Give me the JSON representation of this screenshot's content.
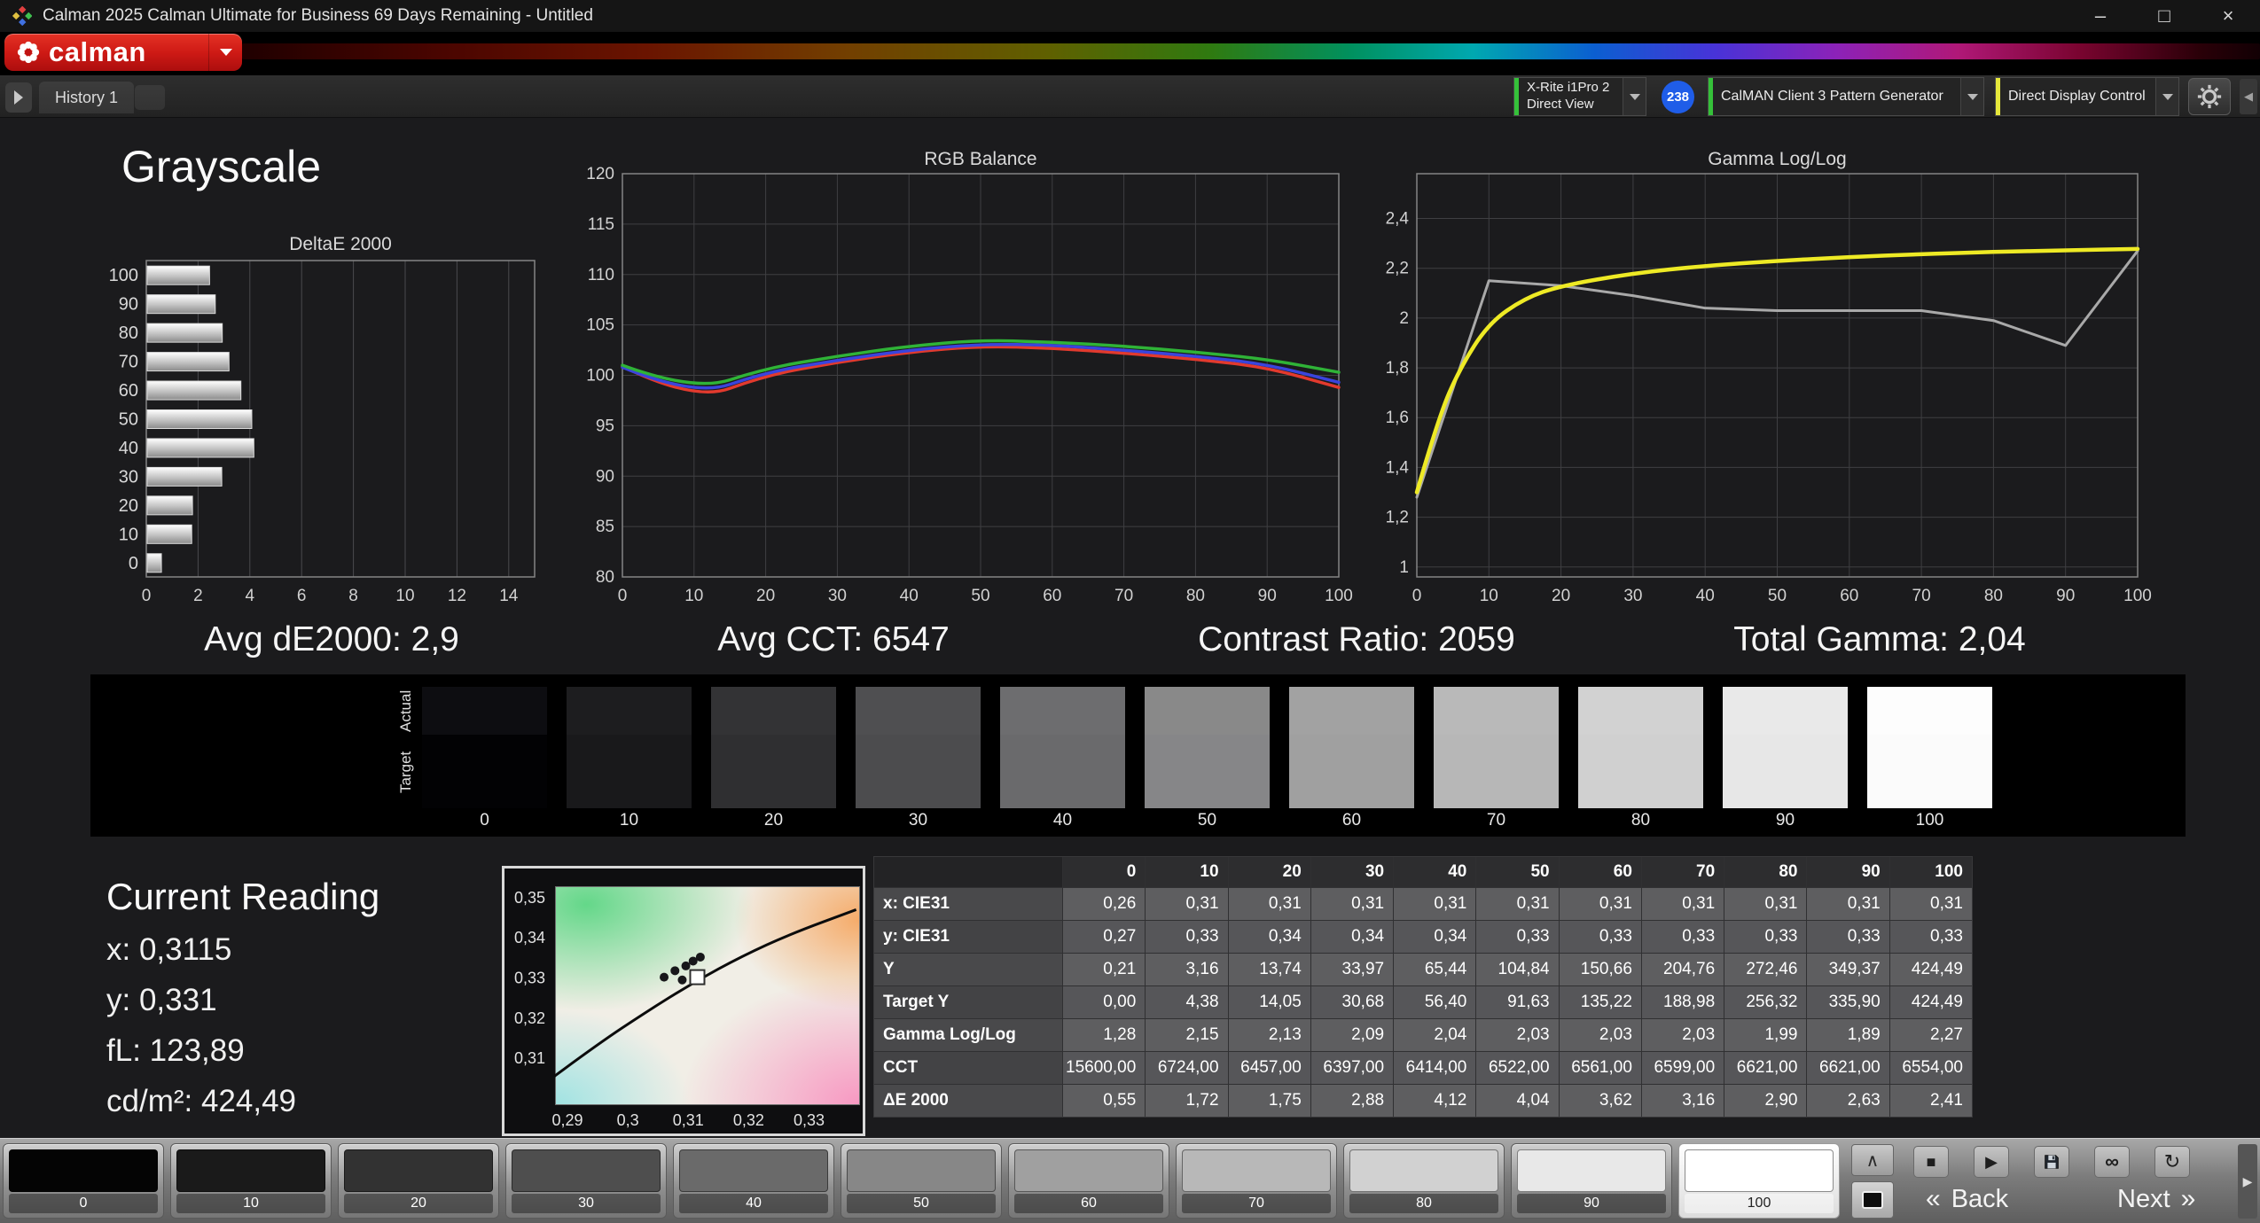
{
  "window": {
    "title": "Calman 2025 Calman Ultimate for Business 69 Days Remaining  - Untitled",
    "minimize": "–",
    "maximize": "□",
    "close": "×"
  },
  "brand": {
    "logo_text": "calman"
  },
  "toolbar": {
    "history_tab": "History 1",
    "meter_line1": "X-Rite i1Pro 2",
    "meter_line2": "Direct View",
    "meter_badge": "238",
    "pattern_source": "CalMAN Client 3 Pattern Generator",
    "display_control": "Direct Display Control",
    "accent_green": "#35c139",
    "accent_yellow": "#e6e83b"
  },
  "page": {
    "title": "Grayscale"
  },
  "stats": [
    "Avg dE2000: 2,9",
    "Avg CCT: 6547",
    "Contrast Ratio: 2059",
    "Total Gamma: 2,04"
  ],
  "current_reading": {
    "title": "Current Reading",
    "lines": [
      "x: 0,3115",
      "y: 0,331",
      "fL: 123,89",
      "cd/m²: 424,49"
    ]
  },
  "ramp": {
    "actual_label": "Actual",
    "target_label": "Target",
    "levels": [
      {
        "label": "0",
        "actual": "#0d0d11",
        "target": "#020204"
      },
      {
        "label": "10",
        "actual": "#1d1d1f",
        "target": "#19191b"
      },
      {
        "label": "20",
        "actual": "#333335",
        "target": "#2f2f31"
      },
      {
        "label": "30",
        "actual": "#4f4f51",
        "target": "#4c4c4e"
      },
      {
        "label": "40",
        "actual": "#6d6d6f",
        "target": "#6a6a6c"
      },
      {
        "label": "50",
        "actual": "#898989",
        "target": "#868688"
      },
      {
        "label": "60",
        "actual": "#a2a2a2",
        "target": "#a0a0a0"
      },
      {
        "label": "70",
        "actual": "#b9b9b9",
        "target": "#b7b7b7"
      },
      {
        "label": "80",
        "actual": "#d2d2d2",
        "target": "#d0d0d0"
      },
      {
        "label": "90",
        "actual": "#e9e9e9",
        "target": "#e7e7e7"
      },
      {
        "label": "100",
        "actual": "#fdfdfd",
        "target": "#fbfbfb"
      }
    ]
  },
  "table": {
    "columns": [
      "0",
      "10",
      "20",
      "30",
      "40",
      "50",
      "60",
      "70",
      "80",
      "90",
      "100"
    ],
    "rows": [
      {
        "label": "x: CIE31",
        "values": [
          "0,26",
          "0,31",
          "0,31",
          "0,31",
          "0,31",
          "0,31",
          "0,31",
          "0,31",
          "0,31",
          "0,31",
          "0,31"
        ]
      },
      {
        "label": "y: CIE31",
        "values": [
          "0,27",
          "0,33",
          "0,34",
          "0,34",
          "0,34",
          "0,33",
          "0,33",
          "0,33",
          "0,33",
          "0,33",
          "0,33"
        ]
      },
      {
        "label": "Y",
        "values": [
          "0,21",
          "3,16",
          "13,74",
          "33,97",
          "65,44",
          "104,84",
          "150,66",
          "204,76",
          "272,46",
          "349,37",
          "424,49"
        ]
      },
      {
        "label": "Target Y",
        "values": [
          "0,00",
          "4,38",
          "14,05",
          "30,68",
          "56,40",
          "91,63",
          "135,22",
          "188,98",
          "256,32",
          "335,90",
          "424,49"
        ]
      },
      {
        "label": "Gamma Log/Log",
        "values": [
          "1,28",
          "2,15",
          "2,13",
          "2,09",
          "2,04",
          "2,03",
          "2,03",
          "2,03",
          "1,99",
          "1,89",
          "2,27"
        ]
      },
      {
        "label": "CCT",
        "values": [
          "15600,00",
          "6724,00",
          "6457,00",
          "6397,00",
          "6414,00",
          "6522,00",
          "6561,00",
          "6599,00",
          "6621,00",
          "6621,00",
          "6554,00"
        ]
      },
      {
        "label": "ΔE 2000",
        "values": [
          "0,55",
          "1,72",
          "1,75",
          "2,88",
          "4,12",
          "4,04",
          "3,62",
          "3,16",
          "2,90",
          "2,63",
          "2,41"
        ]
      }
    ]
  },
  "pattern_bar": {
    "levels": [
      {
        "label": "0",
        "color": "#040404",
        "selected": false
      },
      {
        "label": "10",
        "color": "#1a1a1a",
        "selected": false
      },
      {
        "label": "20",
        "color": "#323232",
        "selected": false
      },
      {
        "label": "30",
        "color": "#4e4e4e",
        "selected": false
      },
      {
        "label": "40",
        "color": "#6a6a6a",
        "selected": false
      },
      {
        "label": "50",
        "color": "#878787",
        "selected": false
      },
      {
        "label": "60",
        "color": "#a0a0a0",
        "selected": false
      },
      {
        "label": "70",
        "color": "#b8b8b8",
        "selected": false
      },
      {
        "label": "80",
        "color": "#d1d1d1",
        "selected": false
      },
      {
        "label": "90",
        "color": "#e8e8e8",
        "selected": false
      },
      {
        "label": "100",
        "color": "#ffffff",
        "selected": true
      }
    ],
    "back_label": "Back",
    "next_label": "Next",
    "back_chevron": "«",
    "next_chevron": "»"
  },
  "icons": {
    "up": "∧",
    "stop": "■",
    "play": "▶",
    "link": "∞",
    "refresh": "↻",
    "edge_left": "◀",
    "edge_right": "▶"
  },
  "chart_data": [
    {
      "id": "deltae",
      "type": "bar",
      "orientation": "horizontal",
      "title": "DeltaE 2000",
      "categories": [
        "100",
        "90",
        "80",
        "70",
        "60",
        "50",
        "40",
        "30",
        "20",
        "10",
        "0"
      ],
      "values": [
        2.41,
        2.63,
        2.9,
        3.16,
        3.62,
        4.04,
        4.12,
        2.88,
        1.75,
        1.72,
        0.55
      ],
      "xlim": [
        0,
        15
      ],
      "xticks": [
        0,
        2,
        4,
        6,
        8,
        10,
        12,
        14
      ],
      "xlabel": "",
      "ylabel": ""
    },
    {
      "id": "rgb",
      "type": "line",
      "title": "RGB Balance",
      "x": [
        0,
        10,
        20,
        30,
        40,
        50,
        60,
        70,
        80,
        90,
        100
      ],
      "xlim": [
        0,
        100
      ],
      "ylim": [
        80,
        120
      ],
      "xticks": [
        0,
        10,
        20,
        30,
        40,
        50,
        60,
        70,
        80,
        90,
        100
      ],
      "yticks": [
        80,
        85,
        90,
        95,
        100,
        105,
        110,
        115,
        120
      ],
      "series": [
        {
          "name": "Red",
          "color": "#e23a2e",
          "smooth": true,
          "values": [
            100.9,
            97.4,
            100.0,
            101.3,
            102.3,
            102.9,
            102.7,
            102.2,
            101.6,
            100.8,
            98.8
          ]
        },
        {
          "name": "Blue",
          "color": "#3a44dd",
          "smooth": true,
          "values": [
            100.8,
            97.9,
            100.3,
            101.5,
            102.5,
            103.1,
            103.0,
            102.5,
            101.9,
            101.1,
            99.3
          ]
        },
        {
          "name": "Green",
          "color": "#2fb337",
          "smooth": true,
          "values": [
            101.0,
            98.4,
            100.7,
            101.9,
            102.9,
            103.5,
            103.3,
            102.9,
            102.3,
            101.6,
            100.3
          ]
        }
      ]
    },
    {
      "id": "gamma",
      "type": "line",
      "title": "Gamma Log/Log",
      "xlim": [
        0,
        100
      ],
      "ylim": [
        0.96,
        2.58
      ],
      "xticks": [
        0,
        10,
        20,
        30,
        40,
        50,
        60,
        70,
        80,
        90,
        100
      ],
      "yticks": [
        1,
        1.2,
        1.4,
        1.6,
        1.8,
        2,
        2.2,
        2.4
      ],
      "series": [
        {
          "name": "Measured",
          "color": "#a9a9a9",
          "smooth": false,
          "x": [
            0,
            10,
            20,
            30,
            40,
            50,
            60,
            70,
            80,
            90,
            100
          ],
          "values": [
            1.28,
            2.15,
            2.13,
            2.09,
            2.04,
            2.03,
            2.03,
            2.03,
            1.99,
            1.89,
            2.27
          ]
        },
        {
          "name": "Target",
          "color": "#eeea25",
          "smooth": true,
          "x": [
            0,
            3,
            6,
            10,
            15,
            20,
            30,
            40,
            50,
            60,
            70,
            80,
            90,
            100
          ],
          "values": [
            1.3,
            1.6,
            1.8,
            1.98,
            2.08,
            2.13,
            2.18,
            2.21,
            2.23,
            2.245,
            2.257,
            2.266,
            2.272,
            2.278
          ]
        }
      ]
    },
    {
      "id": "cie",
      "type": "scatter",
      "title": "CIE 1931 xy (zoom)",
      "xlim": [
        0.2875,
        0.338
      ],
      "ylim": [
        0.299,
        0.3535
      ],
      "xticks": [
        0.29,
        0.3,
        0.31,
        0.32,
        0.33
      ],
      "yticks": [
        0.31,
        0.32,
        0.33,
        0.34,
        0.35
      ],
      "locus": [
        [
          0.2878,
          0.3055
        ],
        [
          0.295,
          0.3135
        ],
        [
          0.303,
          0.3215
        ],
        [
          0.311,
          0.329
        ],
        [
          0.319,
          0.3355
        ],
        [
          0.327,
          0.341
        ],
        [
          0.3378,
          0.347
        ]
      ],
      "points": [
        [
          0.306,
          0.3302
        ],
        [
          0.3078,
          0.3318
        ],
        [
          0.309,
          0.3295
        ],
        [
          0.3096,
          0.333
        ],
        [
          0.3108,
          0.3342
        ],
        [
          0.312,
          0.3352
        ]
      ],
      "marker": [
        0.3115,
        0.3302
      ]
    }
  ]
}
